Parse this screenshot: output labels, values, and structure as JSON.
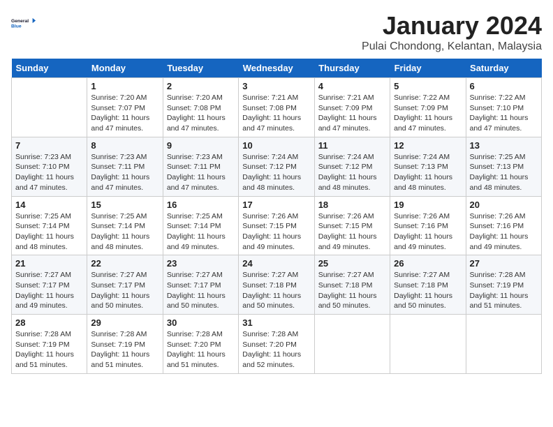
{
  "logo": {
    "line1": "General",
    "line2": "Blue"
  },
  "header": {
    "month": "January 2024",
    "location": "Pulai Chondong, Kelantan, Malaysia"
  },
  "weekdays": [
    "Sunday",
    "Monday",
    "Tuesday",
    "Wednesday",
    "Thursday",
    "Friday",
    "Saturday"
  ],
  "weeks": [
    [
      {
        "day": "",
        "info": ""
      },
      {
        "day": "1",
        "info": "Sunrise: 7:20 AM\nSunset: 7:07 PM\nDaylight: 11 hours\nand 47 minutes."
      },
      {
        "day": "2",
        "info": "Sunrise: 7:20 AM\nSunset: 7:08 PM\nDaylight: 11 hours\nand 47 minutes."
      },
      {
        "day": "3",
        "info": "Sunrise: 7:21 AM\nSunset: 7:08 PM\nDaylight: 11 hours\nand 47 minutes."
      },
      {
        "day": "4",
        "info": "Sunrise: 7:21 AM\nSunset: 7:09 PM\nDaylight: 11 hours\nand 47 minutes."
      },
      {
        "day": "5",
        "info": "Sunrise: 7:22 AM\nSunset: 7:09 PM\nDaylight: 11 hours\nand 47 minutes."
      },
      {
        "day": "6",
        "info": "Sunrise: 7:22 AM\nSunset: 7:10 PM\nDaylight: 11 hours\nand 47 minutes."
      }
    ],
    [
      {
        "day": "7",
        "info": "Sunrise: 7:23 AM\nSunset: 7:10 PM\nDaylight: 11 hours\nand 47 minutes."
      },
      {
        "day": "8",
        "info": "Sunrise: 7:23 AM\nSunset: 7:11 PM\nDaylight: 11 hours\nand 47 minutes."
      },
      {
        "day": "9",
        "info": "Sunrise: 7:23 AM\nSunset: 7:11 PM\nDaylight: 11 hours\nand 47 minutes."
      },
      {
        "day": "10",
        "info": "Sunrise: 7:24 AM\nSunset: 7:12 PM\nDaylight: 11 hours\nand 48 minutes."
      },
      {
        "day": "11",
        "info": "Sunrise: 7:24 AM\nSunset: 7:12 PM\nDaylight: 11 hours\nand 48 minutes."
      },
      {
        "day": "12",
        "info": "Sunrise: 7:24 AM\nSunset: 7:13 PM\nDaylight: 11 hours\nand 48 minutes."
      },
      {
        "day": "13",
        "info": "Sunrise: 7:25 AM\nSunset: 7:13 PM\nDaylight: 11 hours\nand 48 minutes."
      }
    ],
    [
      {
        "day": "14",
        "info": "Sunrise: 7:25 AM\nSunset: 7:14 PM\nDaylight: 11 hours\nand 48 minutes."
      },
      {
        "day": "15",
        "info": "Sunrise: 7:25 AM\nSunset: 7:14 PM\nDaylight: 11 hours\nand 48 minutes."
      },
      {
        "day": "16",
        "info": "Sunrise: 7:25 AM\nSunset: 7:14 PM\nDaylight: 11 hours\nand 49 minutes."
      },
      {
        "day": "17",
        "info": "Sunrise: 7:26 AM\nSunset: 7:15 PM\nDaylight: 11 hours\nand 49 minutes."
      },
      {
        "day": "18",
        "info": "Sunrise: 7:26 AM\nSunset: 7:15 PM\nDaylight: 11 hours\nand 49 minutes."
      },
      {
        "day": "19",
        "info": "Sunrise: 7:26 AM\nSunset: 7:16 PM\nDaylight: 11 hours\nand 49 minutes."
      },
      {
        "day": "20",
        "info": "Sunrise: 7:26 AM\nSunset: 7:16 PM\nDaylight: 11 hours\nand 49 minutes."
      }
    ],
    [
      {
        "day": "21",
        "info": "Sunrise: 7:27 AM\nSunset: 7:17 PM\nDaylight: 11 hours\nand 49 minutes."
      },
      {
        "day": "22",
        "info": "Sunrise: 7:27 AM\nSunset: 7:17 PM\nDaylight: 11 hours\nand 50 minutes."
      },
      {
        "day": "23",
        "info": "Sunrise: 7:27 AM\nSunset: 7:17 PM\nDaylight: 11 hours\nand 50 minutes."
      },
      {
        "day": "24",
        "info": "Sunrise: 7:27 AM\nSunset: 7:18 PM\nDaylight: 11 hours\nand 50 minutes."
      },
      {
        "day": "25",
        "info": "Sunrise: 7:27 AM\nSunset: 7:18 PM\nDaylight: 11 hours\nand 50 minutes."
      },
      {
        "day": "26",
        "info": "Sunrise: 7:27 AM\nSunset: 7:18 PM\nDaylight: 11 hours\nand 50 minutes."
      },
      {
        "day": "27",
        "info": "Sunrise: 7:28 AM\nSunset: 7:19 PM\nDaylight: 11 hours\nand 51 minutes."
      }
    ],
    [
      {
        "day": "28",
        "info": "Sunrise: 7:28 AM\nSunset: 7:19 PM\nDaylight: 11 hours\nand 51 minutes."
      },
      {
        "day": "29",
        "info": "Sunrise: 7:28 AM\nSunset: 7:19 PM\nDaylight: 11 hours\nand 51 minutes."
      },
      {
        "day": "30",
        "info": "Sunrise: 7:28 AM\nSunset: 7:20 PM\nDaylight: 11 hours\nand 51 minutes."
      },
      {
        "day": "31",
        "info": "Sunrise: 7:28 AM\nSunset: 7:20 PM\nDaylight: 11 hours\nand 52 minutes."
      },
      {
        "day": "",
        "info": ""
      },
      {
        "day": "",
        "info": ""
      },
      {
        "day": "",
        "info": ""
      }
    ]
  ]
}
